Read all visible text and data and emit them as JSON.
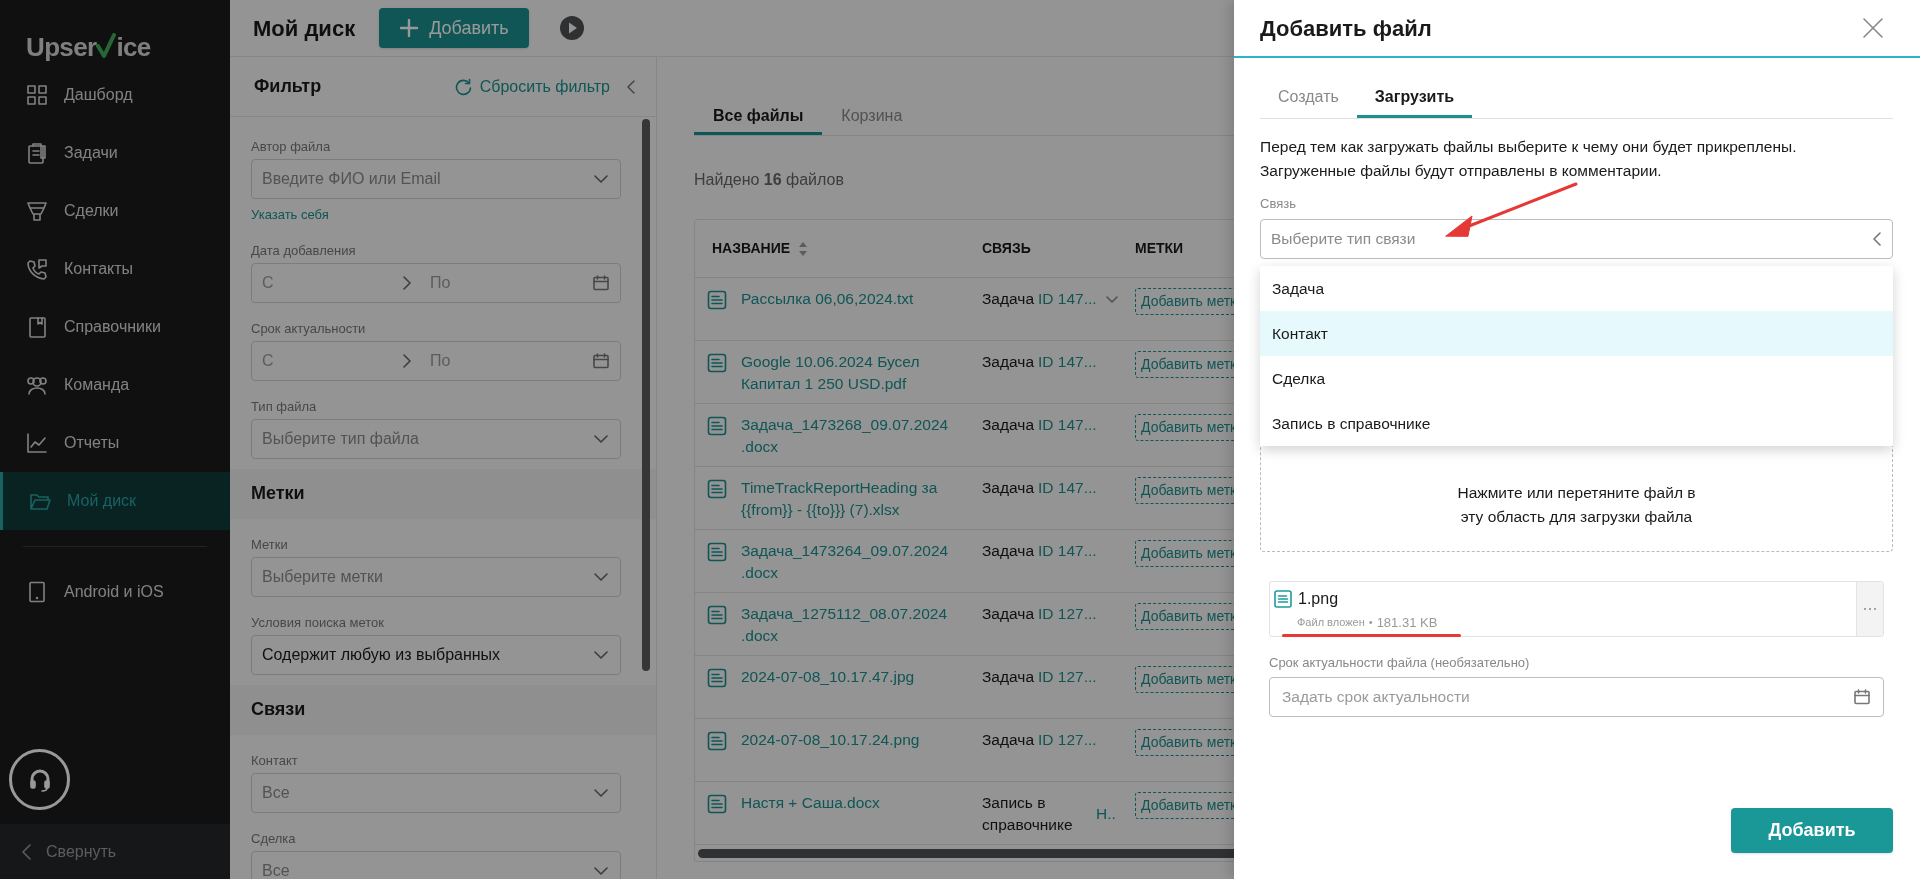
{
  "logo": {
    "before": "Upser",
    "after": "ice"
  },
  "sidebar": {
    "items": [
      {
        "label": "Дашборд",
        "selected": false
      },
      {
        "label": "Задачи",
        "selected": false
      },
      {
        "label": "Сделки",
        "selected": false
      },
      {
        "label": "Контакты",
        "selected": false
      },
      {
        "label": "Справочники",
        "selected": false
      },
      {
        "label": "Команда",
        "selected": false
      },
      {
        "label": "Отчеты",
        "selected": false
      },
      {
        "label": "Мой диск",
        "selected": true
      }
    ],
    "mobile_item": "Android и iOS",
    "collapse": "Свернуть"
  },
  "header": {
    "title": "Мой диск",
    "add_button": "Добавить"
  },
  "filter": {
    "title": "Фильтр",
    "reset": "Сбросить фильтр",
    "items": [
      {
        "kind": "select",
        "label": "Автор файла",
        "placeholder": "Введите ФИО или Email"
      },
      {
        "kind": "link",
        "label": "Указать себя"
      },
      {
        "kind": "date_range",
        "label": "Дата добавления",
        "from": "С",
        "to": "По"
      },
      {
        "kind": "date_range",
        "label": "Срок актуальности",
        "from": "С",
        "to": "По"
      },
      {
        "kind": "select",
        "label": "Тип файла",
        "placeholder": "Выберите тип файла"
      },
      {
        "kind": "section",
        "label": "Метки"
      },
      {
        "kind": "select",
        "label": "Метки",
        "placeholder": "Выберите метки"
      },
      {
        "kind": "select",
        "label": "Условия поиска меток",
        "value": "Содержит любую из выбранных"
      },
      {
        "kind": "section",
        "label": "Связи"
      },
      {
        "kind": "select",
        "label": "Контакт",
        "placeholder": "Все"
      },
      {
        "kind": "select",
        "label": "Сделка",
        "placeholder": "Все"
      }
    ]
  },
  "tabs": [
    {
      "label": "Все файлы",
      "selected": true
    },
    {
      "label": "Корзина",
      "selected": false
    }
  ],
  "found": "Найдено **16** файлов",
  "table": {
    "columns": [
      "НАЗВАНИЕ",
      "СВЯЗЬ",
      "МЕТКИ"
    ],
    "rows": [
      {
        "name": [
          "Рассылка 06,06,2024.txt"
        ],
        "link_type": "Задача",
        "link_id": "ID 147...",
        "expandable": true,
        "tag_button": "Добавить метк"
      },
      {
        "name": [
          "Google 10.06.2024 Бусел",
          "Капитал 1 250 USD.pdf"
        ],
        "link_type": "Задача",
        "link_id": "ID 147...",
        "expandable": false,
        "tag_button": "Добавить метк"
      },
      {
        "name": [
          "Задача_1473268_09.07.2024",
          ".docx"
        ],
        "link_type": "Задача",
        "link_id": "ID 147...",
        "expandable": false,
        "tag_button": "Добавить метк"
      },
      {
        "name": [
          "TimeTrackReportHeading за",
          "{{from}} - {{to}}} (7).xlsx"
        ],
        "link_type": "Задача",
        "link_id": "ID 147...",
        "expandable": false,
        "tag_button": "Добавить метк"
      },
      {
        "name": [
          "Задача_1473264_09.07.2024",
          ".docx"
        ],
        "link_type": "Задача",
        "link_id": "ID 147...",
        "expandable": false,
        "tag_button": "Добавить метк"
      },
      {
        "name": [
          "Задача_1275112_08.07.2024",
          ".docx"
        ],
        "link_type": "Задача",
        "link_id": "ID 127...",
        "expandable": false,
        "tag_button": "Добавить метк"
      },
      {
        "name": [
          "2024-07-08_10.17.47.jpg"
        ],
        "link_type": "Задача",
        "link_id": "ID 127...",
        "expandable": false,
        "tag_button": "Добавить метк"
      },
      {
        "name": [
          "2024-07-08_10.17.24.png"
        ],
        "link_type": "Задача",
        "link_id": "ID 127...",
        "expandable": false,
        "tag_button": "Добавить метк"
      },
      {
        "name": [
          "Настя + Саша.docx"
        ],
        "link_type": "Запись в справочнике",
        "link_id": "Н..",
        "expandable": false,
        "tag_button": "Добавить метк"
      }
    ]
  },
  "drawer": {
    "title": "Добавить файл",
    "tabs": [
      {
        "label": "Создать",
        "selected": false
      },
      {
        "label": "Загрузить",
        "selected": true
      }
    ],
    "description": [
      "Перед тем как загружать файлы выберите к чему они будет прикреплены.",
      "Загруженные файлы будут отправлены в комментарии."
    ],
    "relation": {
      "label": "Связь",
      "placeholder": "Выберите тип связи",
      "options": [
        {
          "label": "Задача",
          "selected": false
        },
        {
          "label": "Контакт",
          "selected": true
        },
        {
          "label": "Сделка",
          "selected": false
        },
        {
          "label": "Запись в справочнике",
          "selected": false
        }
      ]
    },
    "dropzone": [
      "Нажмите или перетяните файл в",
      "эту область для загрузки файла"
    ],
    "file": {
      "name": "1.png",
      "status": "Файл вложен",
      "separator": "•",
      "size": "181.31 KB"
    },
    "expiry": {
      "label": "Срок актуальности файла (необязательно)",
      "placeholder": "Задать срок актуальности"
    },
    "submit": "Добавить"
  }
}
